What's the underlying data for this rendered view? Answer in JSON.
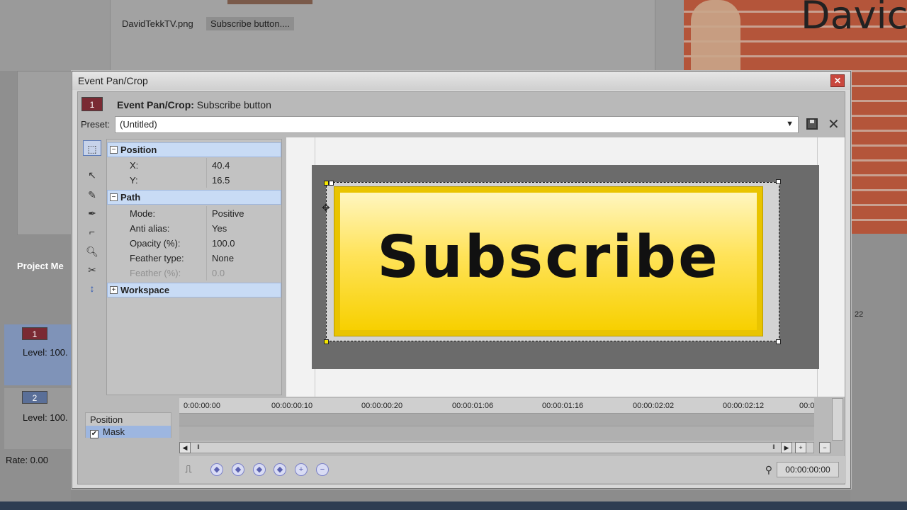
{
  "background": {
    "files": [
      "DavidTekkTV.png",
      "Subscribe button...."
    ],
    "brand_text": "Davic",
    "project_label": "Project Me",
    "tracks": [
      {
        "number": "1",
        "level": "Level: 100."
      },
      {
        "number": "2",
        "level": "Level: 100."
      }
    ],
    "rate": "Rate: 0.00",
    "time_fragment": "22"
  },
  "dialog": {
    "window_title": "Event Pan/Crop",
    "event_number": "1",
    "header_label": "Event Pan/Crop:",
    "header_event": "Subscribe button",
    "preset_label": "Preset:",
    "preset_value": "(Untitled)"
  },
  "properties": {
    "position": {
      "label": "Position",
      "x_label": "X:",
      "x_value": "40.4",
      "y_label": "Y:",
      "y_value": "16.5"
    },
    "path": {
      "label": "Path",
      "rows": [
        {
          "key": "Mode:",
          "value": "Positive"
        },
        {
          "key": "Anti alias:",
          "value": "Yes"
        },
        {
          "key": "Opacity (%):",
          "value": "100.0"
        },
        {
          "key": "Feather type:",
          "value": "None"
        },
        {
          "key": "Feather (%):",
          "value": "0.0"
        }
      ]
    },
    "workspace": {
      "label": "Workspace"
    }
  },
  "canvas": {
    "button_text": "Subscribe"
  },
  "timeline": {
    "items": [
      "Position",
      "Mask"
    ],
    "ticks": [
      "0:00:00:00",
      "00:00:00:10",
      "00:00:00:20",
      "00:00:01:06",
      "00:00:01:16",
      "00:00:02:02",
      "00:00:02:12",
      "00:0"
    ],
    "current_time": "00:00:00:00"
  },
  "colors": {
    "accent_selection": "#c8dbf5",
    "button_yellow": "#f7d000",
    "event_badge": "#7a2a33"
  }
}
